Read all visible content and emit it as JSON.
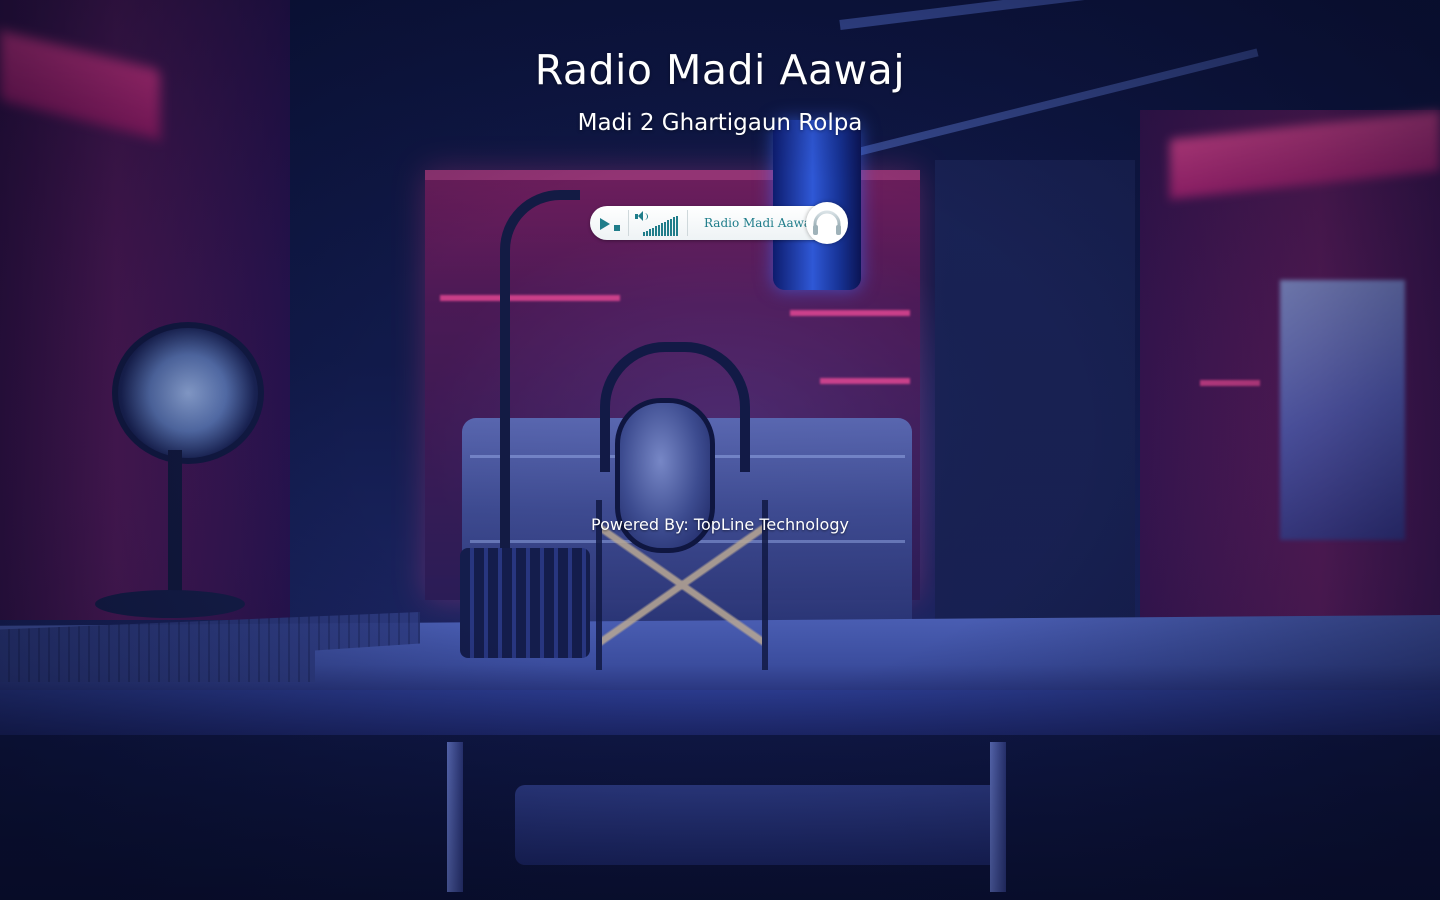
{
  "header": {
    "title": "Radio Madi Aawaj",
    "subtitle": "Madi 2 Ghartigaun Rolpa"
  },
  "player": {
    "play_icon": "play-icon",
    "stop_icon": "stop-icon",
    "volume_icon": "speaker-icon",
    "volume_level": 1.0,
    "station_name": "Radio Madi Aawaj",
    "brand_icon": "headphones-icon",
    "accent_color": "#1f7d8a"
  },
  "footer": {
    "powered_by": "Powered By: TopLine Technology"
  },
  "colors": {
    "background": "#0b1336",
    "text": "#ffffff",
    "player_bg": "#ffffff"
  }
}
